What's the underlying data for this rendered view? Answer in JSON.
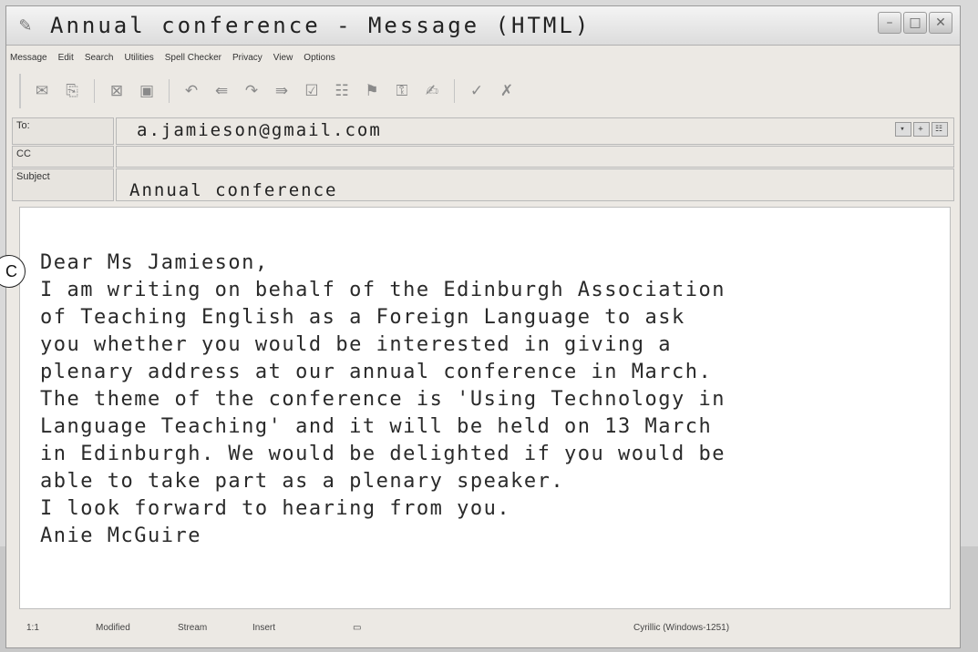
{
  "window": {
    "title": "Annual conference - Message (HTML)",
    "icon": "letter-icon"
  },
  "menu": [
    "Message",
    "Edit",
    "Search",
    "Utilities",
    "Spell Checker",
    "Privacy",
    "View",
    "Options"
  ],
  "toolbar_icons": [
    "send-icon",
    "attach-icon",
    "delete-icon",
    "image-icon",
    "reply-icon",
    "reply-all-icon",
    "forward-icon",
    "forward-attach-icon",
    "check-names-icon",
    "address-book-icon",
    "flag-icon",
    "encrypt-icon",
    "sign-icon",
    "spell-check-icon",
    "close-message-icon"
  ],
  "header": {
    "to_label": "To:",
    "to_value": "a.jamieson@gmail.com",
    "cc_label": "CC",
    "cc_value": "",
    "subject_label": "Subject",
    "subject_value": "Annual conference"
  },
  "body": {
    "lines": [
      "Dear Ms Jamieson,",
      "I am writing on behalf of the Edinburgh Association",
      "of Teaching English as a Foreign Language to ask",
      "you whether you would be interested in giving a",
      "plenary address at our annual conference in March.",
      "The theme of the conference is 'Using Technology in",
      "Language Teaching' and it will be held on 13 March",
      "in Edinburgh. We would be delighted if you would be",
      "able to take part as a plenary speaker.",
      "I look forward to hearing from you.",
      "Anie McGuire"
    ],
    "marker": "C"
  },
  "status": {
    "position": "1:1",
    "modified": "Modified",
    "stream": "Stream",
    "insert": "Insert",
    "encoding": "Cyrillic (Windows-1251)"
  }
}
